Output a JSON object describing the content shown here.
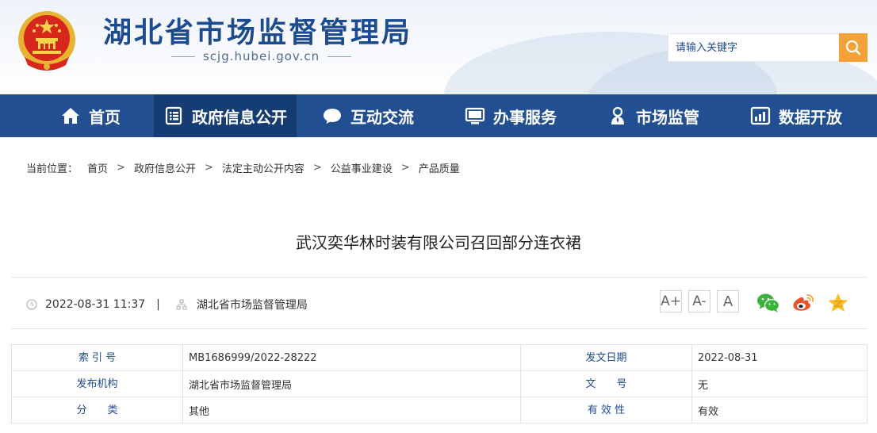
{
  "header": {
    "site_title": "湖北省市场监督管理局",
    "site_url": "scjg.hubei.gov.cn",
    "search": {
      "placeholder": "请输入关键字",
      "value": ""
    }
  },
  "nav": {
    "items": [
      {
        "label": "首页",
        "icon": "home-icon"
      },
      {
        "label": "政府信息公开",
        "icon": "document-list-icon",
        "active": true
      },
      {
        "label": "互动交流",
        "icon": "chat-bubble-icon"
      },
      {
        "label": "办事服务",
        "icon": "monitor-icon"
      },
      {
        "label": "市场监管",
        "icon": "inspector-person-icon"
      },
      {
        "label": "数据开放",
        "icon": "bar-chart-icon"
      }
    ]
  },
  "breadcrumb": {
    "prefix": "当前位置：",
    "items": [
      "首页",
      "政府信息公开",
      "法定主动公开内容",
      "公益事业建设",
      "产品质量"
    ]
  },
  "article": {
    "title": "武汉奕华林时装有限公司召回部分连衣裙",
    "datetime": "2022-08-31 11:37",
    "divider": "|",
    "source": "湖北省市场监督管理局",
    "font_sizes": [
      "A+",
      "A-",
      "A"
    ]
  },
  "info_table": {
    "rows": [
      {
        "label1": "索 引 号",
        "value1": "MB1686999/2022-28222",
        "label2": "发文日期",
        "value2": "2022-08-31"
      },
      {
        "label1": "发布机构",
        "value1": "湖北省市场监督管理局",
        "label2": "文　　号",
        "value2": "无"
      },
      {
        "label1": "分　　类",
        "value1": "其他",
        "label2": "有 效 性",
        "value2": "有效"
      }
    ]
  },
  "colors": {
    "nav_bg": "#214f92",
    "nav_active": "#163c74",
    "title_blue": "#1d4b8f",
    "search_button": "#f3a23a"
  }
}
